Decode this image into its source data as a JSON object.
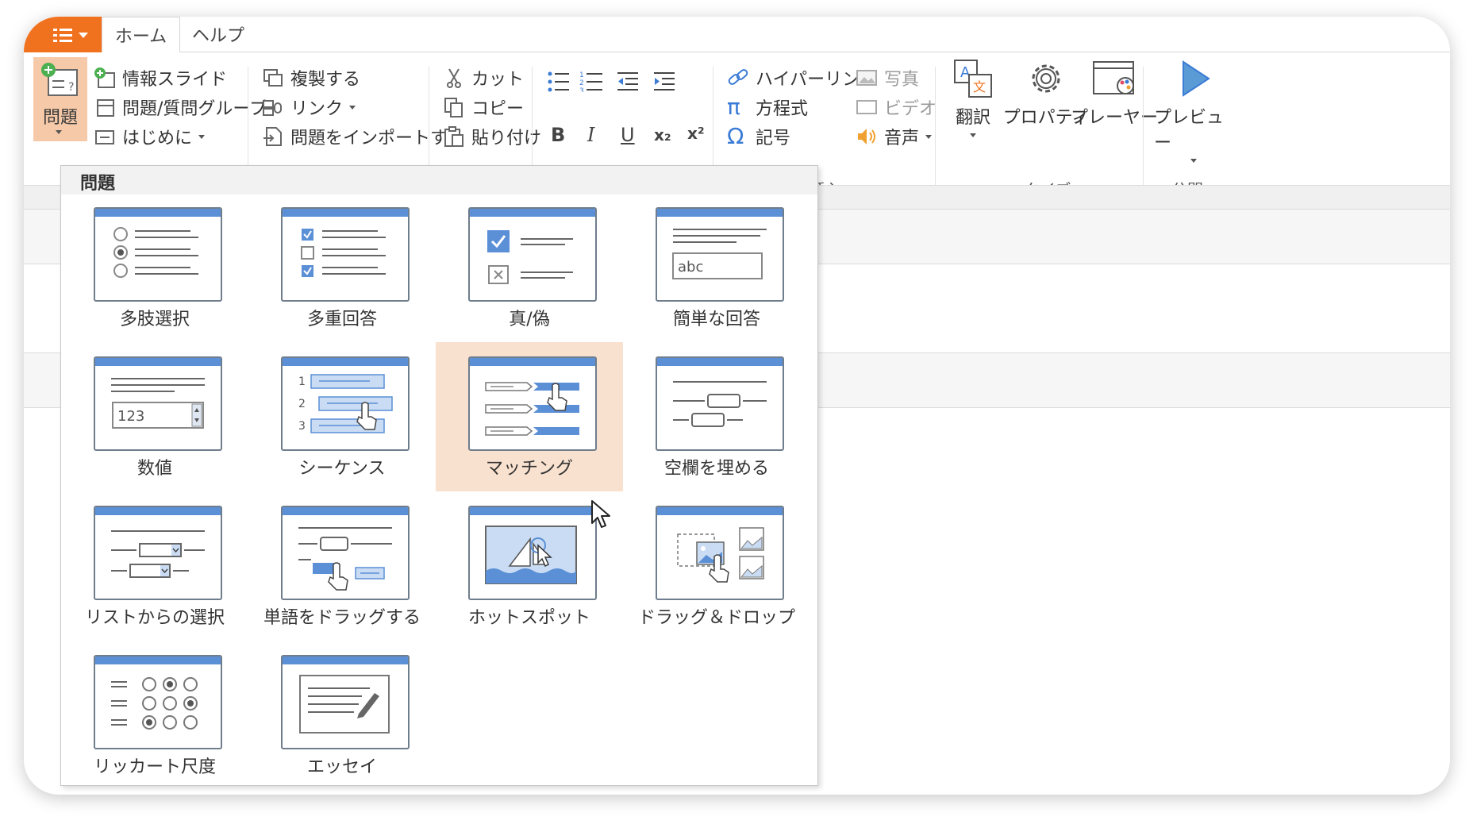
{
  "tabs": {
    "file_icon": "menu-icon",
    "home": "ホーム",
    "help": "ヘルプ"
  },
  "ribbon": {
    "question_button": "問題",
    "info_slide": "情報スライド",
    "question_group": "問題/質問グループ",
    "intro": "はじめに",
    "duplicate": "複製する",
    "link": "リンク",
    "import_questions": "問題をインポートする",
    "cut": "カット",
    "copy": "コピー",
    "paste": "貼り付け",
    "bold": "B",
    "italic": "I",
    "underline": "U",
    "subscript": "x₂",
    "superscript": "x²",
    "hyperlink": "ハイパーリンク",
    "equation": "方程式",
    "symbol": "記号",
    "photo": "写真",
    "video": "ビデオ",
    "audio": "音声",
    "insert_group": "挿入",
    "translate": "翻訳",
    "properties": "プロパティ",
    "player": "プレーヤー",
    "quiz_group": "クイズ",
    "preview": "プレビュー",
    "publish_group": "公開"
  },
  "dropdown": {
    "title": "問題",
    "items": [
      {
        "label": "多肢選択",
        "icon": "multiple-choice-icon"
      },
      {
        "label": "多重回答",
        "icon": "multiple-response-icon"
      },
      {
        "label": "真/偽",
        "icon": "true-false-icon"
      },
      {
        "label": "簡単な回答",
        "icon": "short-answer-icon"
      },
      {
        "label": "数値",
        "icon": "numeric-icon"
      },
      {
        "label": "シーケンス",
        "icon": "sequence-icon"
      },
      {
        "label": "マッチング",
        "icon": "matching-icon"
      },
      {
        "label": "空欄を埋める",
        "icon": "fill-in-blanks-icon"
      },
      {
        "label": "リストからの選択",
        "icon": "select-from-lists-icon"
      },
      {
        "label": "単語をドラッグする",
        "icon": "drag-words-icon"
      },
      {
        "label": "ホットスポット",
        "icon": "hotspot-icon"
      },
      {
        "label": "ドラッグ＆ドロップ",
        "icon": "drag-and-drop-icon"
      },
      {
        "label": "リッカート尺度",
        "icon": "likert-scale-icon"
      },
      {
        "label": "エッセイ",
        "icon": "essay-icon"
      }
    ],
    "numeric_sample": "123",
    "short_answer_sample": "abc",
    "sequence_numbers": [
      "1",
      "2",
      "3"
    ]
  },
  "colors": {
    "accent": "#f0721f",
    "icon_blue": "#5b8fd6",
    "hover": "#f9e1cf"
  }
}
